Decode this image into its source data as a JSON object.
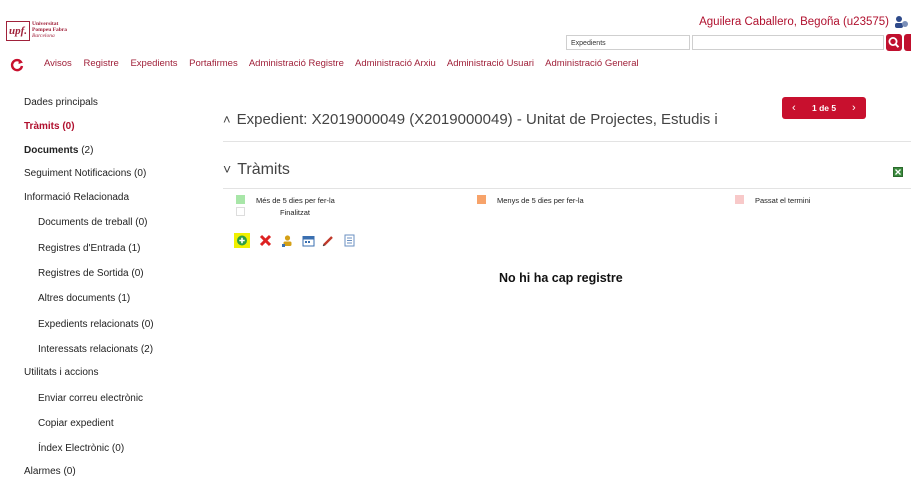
{
  "header": {
    "logo_mark": "upf.",
    "logo_lines": [
      "Universitat",
      "Pompeu Fabra",
      "Barcelona"
    ],
    "user_name": "Aguilera Caballero, Begoña (u23575)",
    "search_scope": "Expedients",
    "search_value": ""
  },
  "nav": {
    "items": [
      "Avisos",
      "Registre",
      "Expedients",
      "Portafirmes",
      "Administració Registre",
      "Administració Arxiu",
      "Administració Usuari",
      "Administració General"
    ]
  },
  "sidebar": {
    "items": [
      {
        "label": "Dades principals",
        "count": ""
      },
      {
        "label": "Tràmits (0)",
        "count": ""
      },
      {
        "label": "Documents",
        "count": " (2)"
      },
      {
        "label": "Seguiment Notificacions (0)",
        "count": ""
      },
      {
        "label": "Informació Relacionada",
        "count": ""
      },
      {
        "label": "Documents de treball (0)",
        "count": ""
      },
      {
        "label": "Registres d'Entrada (1)",
        "count": ""
      },
      {
        "label": "Registres de Sortida (0)",
        "count": ""
      },
      {
        "label": "Altres documents (1)",
        "count": ""
      },
      {
        "label": "Expedients relacionats (0)",
        "count": ""
      },
      {
        "label": "Interessats relacionats (2)",
        "count": ""
      },
      {
        "label": "Utilitats i accions",
        "count": ""
      },
      {
        "label": "Enviar correu electrònic",
        "count": ""
      },
      {
        "label": "Copiar expedient",
        "count": ""
      },
      {
        "label": "Índex Electrònic (0)",
        "count": ""
      },
      {
        "label": "Alarmes (0)",
        "count": ""
      }
    ]
  },
  "main": {
    "expedient_title": "Expedient: X2019000049 (X2019000049) - Unitat de Projectes, Estudis i",
    "pager": {
      "label": "1 de 5",
      "prev": "‹",
      "next": "›"
    },
    "section_title": "Tràmits",
    "legend": [
      {
        "label": "Més de 5 dies per fer-la",
        "color": "#a8e6a8"
      },
      {
        "label": "Menys de 5 dies per fer-la",
        "color": "#f7a36a"
      },
      {
        "label": "Passat el termini",
        "color": "#f8c9c9"
      },
      {
        "label": "Finalitzat",
        "color": "#ffffff"
      }
    ],
    "empty_message": "No hi ha cap registre"
  },
  "colors": {
    "accent": "#c8102e",
    "link": "#a0213a"
  }
}
